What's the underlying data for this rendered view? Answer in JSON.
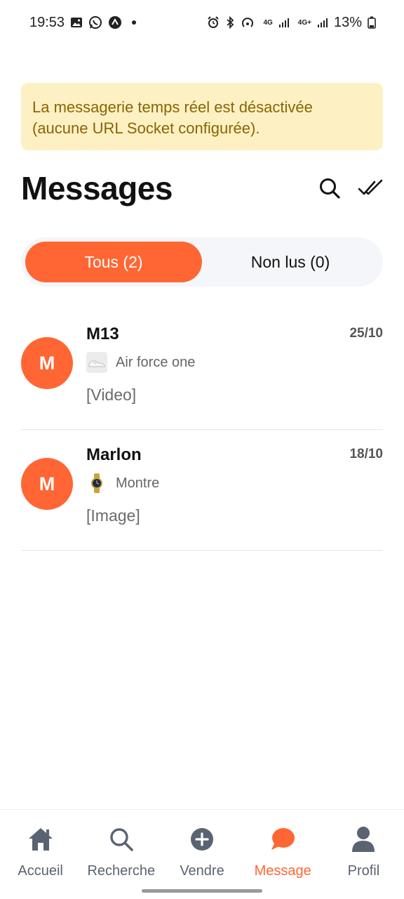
{
  "status_bar": {
    "time": "19:53",
    "left_icons": [
      "image-icon",
      "whatsapp-icon",
      "app-icon"
    ],
    "network_labels": [
      "4G",
      "4G+"
    ],
    "battery": "13%"
  },
  "banner": {
    "text": "La messagerie temps réel est désactivée (aucune URL Socket configurée)."
  },
  "header": {
    "title": "Messages",
    "icons": [
      "search-icon",
      "mark-all-read-icon"
    ]
  },
  "tabs": [
    {
      "label": "Tous (2)",
      "active": true
    },
    {
      "label": "Non lus (0)",
      "active": false
    }
  ],
  "conversations": [
    {
      "avatar": "M",
      "name": "M13",
      "date": "25/10",
      "product": "Air force one",
      "thumbnail": "shoe-thumbnail",
      "last_message": "[Video]"
    },
    {
      "avatar": "M",
      "name": "Marlon",
      "date": "18/10",
      "product": "Montre",
      "thumbnail": "watch-thumbnail",
      "last_message": "[Image]"
    }
  ],
  "bottom_nav": [
    {
      "label": "Accueil",
      "icon": "home-icon",
      "active": false
    },
    {
      "label": "Recherche",
      "icon": "search-icon",
      "active": false
    },
    {
      "label": "Vendre",
      "icon": "plus-circle-icon",
      "active": false
    },
    {
      "label": "Message",
      "icon": "chat-bubble-icon",
      "active": true
    },
    {
      "label": "Profil",
      "icon": "user-icon",
      "active": false
    }
  ],
  "colors": {
    "accent": "#ff6633",
    "banner_bg": "#fdf1c4",
    "banner_text": "#8a6400",
    "nav_inactive": "#5a6372"
  }
}
